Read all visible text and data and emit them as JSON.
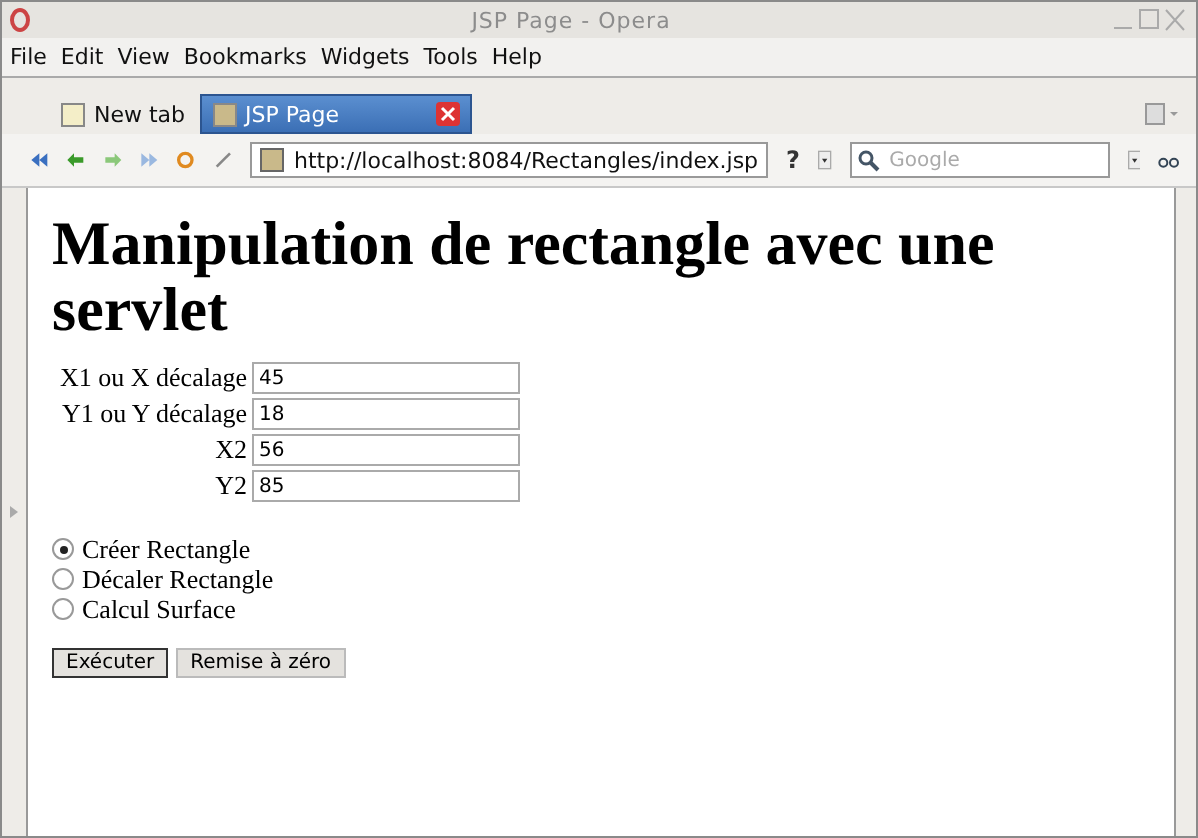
{
  "window": {
    "title": "JSP Page - Opera"
  },
  "menu": [
    "File",
    "Edit",
    "View",
    "Bookmarks",
    "Widgets",
    "Tools",
    "Help"
  ],
  "tabs": [
    {
      "label": "New tab",
      "selected": false
    },
    {
      "label": "JSP Page",
      "selected": true
    }
  ],
  "address": {
    "value": "http://localhost:8084/Rectangles/index.jsp"
  },
  "help_button": "?",
  "search": {
    "placeholder": "Google"
  },
  "page": {
    "heading": "Manipulation de rectangle avec une servlet",
    "fields": [
      {
        "label": "X1 ou X décalage",
        "value": "45"
      },
      {
        "label": "Y1 ou Y décalage",
        "value": "18"
      },
      {
        "label": "X2",
        "value": "56"
      },
      {
        "label": "Y2",
        "value": "85"
      }
    ],
    "options": [
      {
        "label": "Créer Rectangle",
        "selected": true
      },
      {
        "label": "Décaler Rectangle",
        "selected": false
      },
      {
        "label": "Calcul Surface",
        "selected": false
      }
    ],
    "buttons": [
      "Exécuter",
      "Remise à zéro"
    ]
  }
}
